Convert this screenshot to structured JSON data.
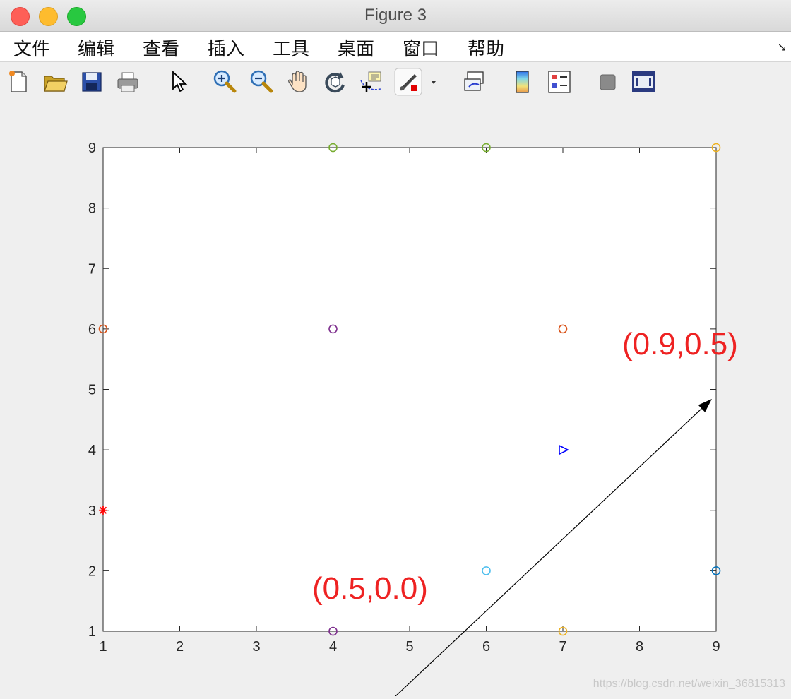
{
  "window": {
    "title": "Figure 3"
  },
  "menu": [
    "文件",
    "编辑",
    "查看",
    "插入",
    "工具",
    "桌面",
    "窗口",
    "帮助"
  ],
  "toolbar": {
    "icons": [
      "new-figure-icon",
      "open-file-icon",
      "save-icon",
      "print-icon",
      "pointer-icon",
      "zoom-in-icon",
      "zoom-out-icon",
      "pan-hand-icon",
      "rotate-3d-icon",
      "data-cursor-icon",
      "brush-icon",
      "brush-dropdown-icon",
      "link-plot-icon",
      "colorbar-icon",
      "legend-icon",
      "hide-plot-tools-icon",
      "show-plot-tools-icon"
    ]
  },
  "chart_data": {
    "type": "scatter",
    "xlim": [
      1,
      9
    ],
    "ylim": [
      1,
      9
    ],
    "xticks": [
      1,
      2,
      3,
      4,
      5,
      6,
      7,
      8,
      9
    ],
    "yticks": [
      1,
      2,
      3,
      4,
      5,
      6,
      7,
      8,
      9
    ],
    "points": [
      {
        "x": 1,
        "y": 6,
        "marker": "o",
        "color": "#d95319"
      },
      {
        "x": 1,
        "y": 3,
        "marker": "*",
        "color": "#ff0000"
      },
      {
        "x": 4,
        "y": 9,
        "marker": "o",
        "color": "#77ac30"
      },
      {
        "x": 4,
        "y": 6,
        "marker": "o",
        "color": "#7e2f8e"
      },
      {
        "x": 4,
        "y": 1,
        "marker": "o",
        "color": "#7e2f8e"
      },
      {
        "x": 6,
        "y": 9,
        "marker": "o",
        "color": "#77ac30"
      },
      {
        "x": 6,
        "y": 2,
        "marker": "o",
        "color": "#4dbeee"
      },
      {
        "x": 7,
        "y": 6,
        "marker": "o",
        "color": "#d95319"
      },
      {
        "x": 7,
        "y": 4,
        "marker": ">",
        "color": "#0000ff"
      },
      {
        "x": 7,
        "y": 1,
        "marker": "o",
        "color": "#edb120"
      },
      {
        "x": 9,
        "y": 9,
        "marker": "o",
        "color": "#edb120"
      },
      {
        "x": 9,
        "y": 2,
        "marker": "o",
        "color": "#0072bd"
      }
    ],
    "annotations": [
      {
        "text": "(0.5,0.0)",
        "color": "#ee2222"
      },
      {
        "text": "(0.9,0.5)",
        "color": "#ee2222"
      }
    ],
    "arrow": {
      "from_norm": [
        0.5,
        0.0
      ],
      "to_norm": [
        0.9,
        0.5
      ]
    }
  },
  "watermark": "https://blog.csdn.net/weixin_36815313"
}
